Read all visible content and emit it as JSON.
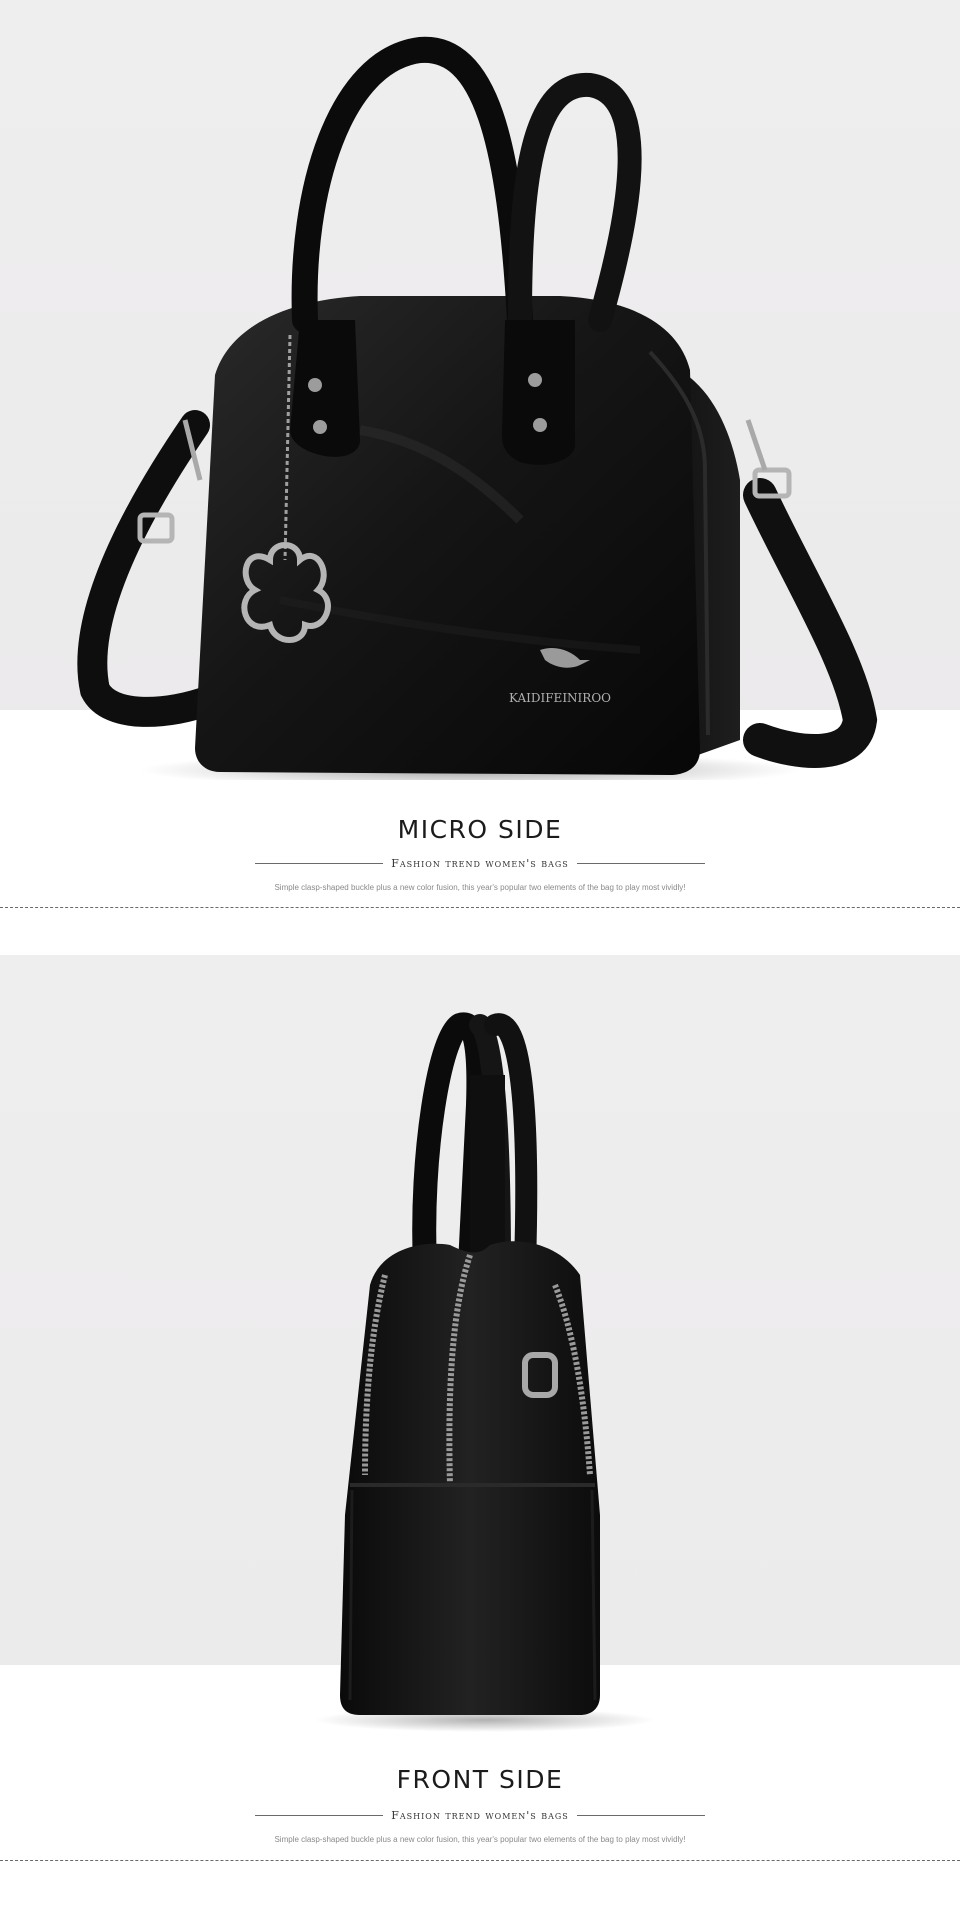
{
  "sections": [
    {
      "title": "MICRO SIDE",
      "subtitle": "Fashion trend women's bags",
      "caption": "Simple clasp-shaped buckle plus a new color fusion, this year's popular two elements of the bag to play most vividly!",
      "photo": {
        "subject": "black leather shell handbag, three-quarter view",
        "brand_plate": "KAIDIFEINIROO"
      }
    },
    {
      "title": "FRONT SIDE",
      "subtitle": "Fashion trend women's bags",
      "caption": "Simple clasp-shaped buckle plus a new color fusion, this year's popular two elements of the bag to play most vividly!",
      "photo": {
        "subject": "black leather shell handbag, side profile"
      }
    }
  ],
  "colors": {
    "background": "#ebeaeb",
    "bag": "#111111",
    "hardware": "#b8b8b8",
    "rule": "#6a6a6a"
  }
}
